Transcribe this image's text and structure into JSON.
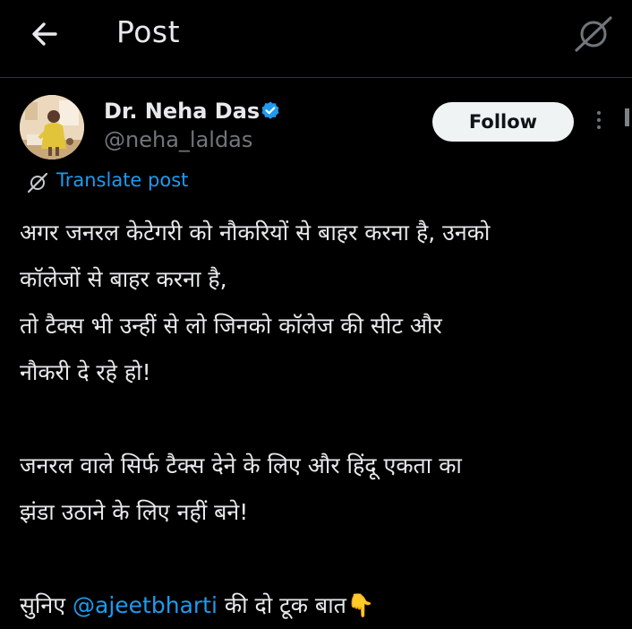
{
  "header": {
    "title": "Post",
    "back_icon": "back-arrow-icon",
    "right_icon": "grok-icon"
  },
  "author": {
    "name": "Dr. Neha Das",
    "handle": "@neha_laldas",
    "verified": true,
    "verified_color": "#1d9bf0"
  },
  "actions": {
    "follow_label": "Follow",
    "more_icon": "more-vertical-icon"
  },
  "translate": {
    "label": "Translate post",
    "icon": "grok-icon"
  },
  "post": {
    "lines": [
      "अगर जनरल केटेगरी को नौकरियों से बाहर करना है, उनको",
      "कॉलेजों से बाहर करना है,",
      "तो टैक्स भी उन्हीं से लो जिनको कॉलेज की सीट और",
      "नौकरी दे रहे हो!",
      "जनरल वाले सिर्फ टैक्स देने के लिए और हिंदू एकता का",
      "झंडा उठाने के लिए नहीं बने!"
    ],
    "last_line_prefix": "सुनिए ",
    "mention": "@ajeetbharti",
    "last_line_suffix": " की दो टूक बात",
    "emoji": "👇"
  },
  "colors": {
    "background": "#000000",
    "text": "#e7e9ea",
    "secondary_text": "#71767b",
    "link": "#1d9bf0",
    "follow_button_bg": "#eff3f4"
  }
}
